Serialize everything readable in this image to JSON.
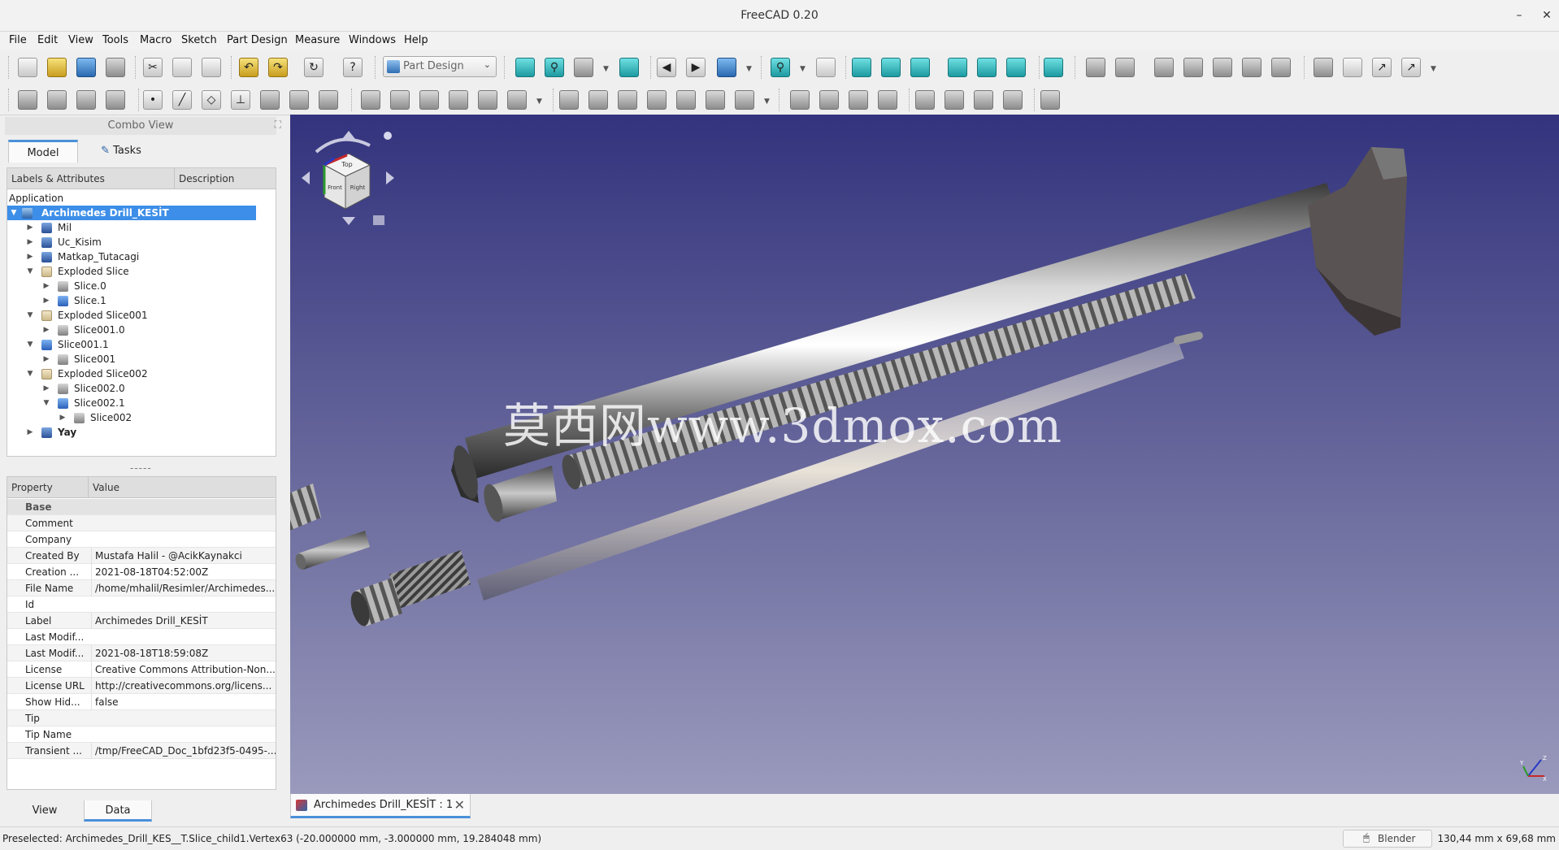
{
  "window": {
    "title": "FreeCAD 0.20",
    "minimize_glyph": "–",
    "close_glyph": "✕"
  },
  "menu": [
    "File",
    "Edit",
    "View",
    "Tools",
    "Macro",
    "Sketch",
    "Part Design",
    "Measure",
    "Windows",
    "Help"
  ],
  "toolbar": {
    "workbench": "Part Design"
  },
  "combo_view": {
    "title": "Combo View",
    "tabs": [
      "Model",
      "Tasks"
    ],
    "tree_headers": [
      "Labels & Attributes",
      "Description"
    ],
    "section_label": "Application",
    "tree": [
      {
        "label": "Archimedes Drill_KESİT",
        "icon": "document-icon",
        "expanded": true,
        "selected": true
      },
      {
        "label": "Mil",
        "icon": "body-icon",
        "expanded": false
      },
      {
        "label": "Uc_Kisim",
        "icon": "body-icon",
        "expanded": false
      },
      {
        "label": "Matkap_Tutacagi",
        "icon": "body-icon",
        "expanded": false
      },
      {
        "label": "Exploded Slice",
        "icon": "folder-icon",
        "expanded": true
      },
      {
        "label": "Slice.0",
        "icon": "part-icon",
        "expanded": false
      },
      {
        "label": "Slice.1",
        "icon": "bluebox-icon",
        "expanded": false
      },
      {
        "label": "Exploded Slice001",
        "icon": "folder-icon",
        "expanded": true
      },
      {
        "label": "Slice001.0",
        "icon": "part-icon",
        "expanded": false
      },
      {
        "label": "Slice001.1",
        "icon": "bluebox-icon",
        "expanded": true
      },
      {
        "label": "Slice001",
        "icon": "part-icon",
        "expanded": false
      },
      {
        "label": "Exploded Slice002",
        "icon": "folder-icon",
        "expanded": true
      },
      {
        "label": "Slice002.0",
        "icon": "part-icon",
        "expanded": false
      },
      {
        "label": "Slice002.1",
        "icon": "bluebox-icon",
        "expanded": true
      },
      {
        "label": "Slice002",
        "icon": "part-icon",
        "expanded": false
      },
      {
        "label": "Yay",
        "icon": "body-icon",
        "expanded": false,
        "bold": true
      }
    ],
    "splitter_label": "-----",
    "property_headers": [
      "Property",
      "Value"
    ],
    "property_group": "Base",
    "properties": [
      {
        "name": "Comment",
        "value": ""
      },
      {
        "name": "Company",
        "value": ""
      },
      {
        "name": "Created By",
        "value": "Mustafa Halil - @AcikKaynakci"
      },
      {
        "name": "Creation ...",
        "value": "2021-08-18T04:52:00Z"
      },
      {
        "name": "File Name",
        "value": "/home/mhalil/Resimler/Archimedes..."
      },
      {
        "name": "Id",
        "value": ""
      },
      {
        "name": "Label",
        "value": "Archimedes Drill_KESİT"
      },
      {
        "name": "Last Modif...",
        "value": ""
      },
      {
        "name": "Last Modif...",
        "value": "2021-08-18T18:59:08Z"
      },
      {
        "name": "License",
        "value": "Creative Commons Attribution-Non..."
      },
      {
        "name": "License URL",
        "value": "http://creativecommons.org/licens..."
      },
      {
        "name": "Show Hid...",
        "value": "false"
      },
      {
        "name": "Tip",
        "value": ""
      },
      {
        "name": "Tip Name",
        "value": ""
      },
      {
        "name": "Transient ...",
        "value": "/tmp/FreeCAD_Doc_1bfd23f5-0495-..."
      }
    ],
    "bottom_tabs": [
      "View",
      "Data"
    ]
  },
  "viewport": {
    "watermark": "莫西网www.3dmox.com",
    "background_top": "#33337e",
    "background_bottom": "#9a9abd",
    "navcube_faces": [
      "Front",
      "Top",
      "Right"
    ],
    "axis_labels": [
      "Z",
      "Y",
      "X"
    ]
  },
  "document_tab": {
    "label": "Archimedes Drill_KESİT : 1",
    "close_glyph": "✕"
  },
  "status_bar": {
    "message": "Preselected: Archimedes_Drill_KES__T.Slice_child1.Vertex63 (-20.000000 mm, -3.000000 mm, 19.284048 mm)",
    "navigation_style": "Blender",
    "dimensions": "130,44 mm x 69,68 mm"
  }
}
